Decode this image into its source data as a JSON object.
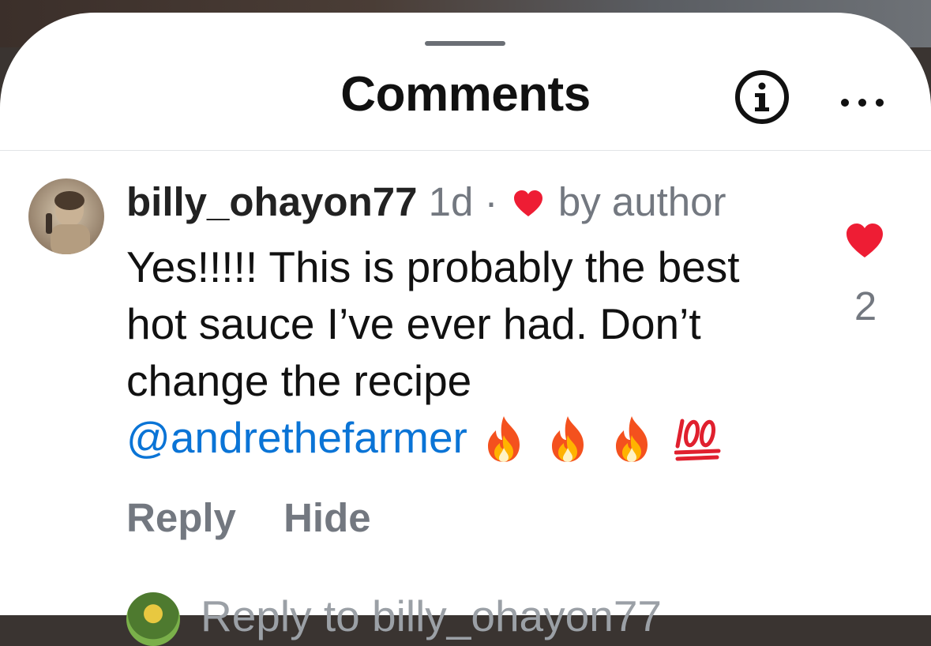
{
  "header": {
    "title": "Comments"
  },
  "comment": {
    "username": "billy_ohayon77",
    "time": "1d",
    "dot": "·",
    "liked_by": "by author",
    "body_line1": "Yes!!!!! This is probably the best",
    "body_line2": "hot sauce I’ve ever had. Don’t",
    "body_line3": "change the recipe",
    "mention": "@andrethefarmer",
    "emojis": [
      "fire",
      "fire",
      "fire",
      "hundred-points"
    ],
    "like_count": "2",
    "actions": {
      "reply": "Reply",
      "hide": "Hide"
    }
  },
  "reply_composer": {
    "placeholder": "Reply to billy_ohayon77"
  },
  "colors": {
    "accent_link": "#0a74d6",
    "heart": "#ee1d34",
    "muted": "#737880"
  }
}
